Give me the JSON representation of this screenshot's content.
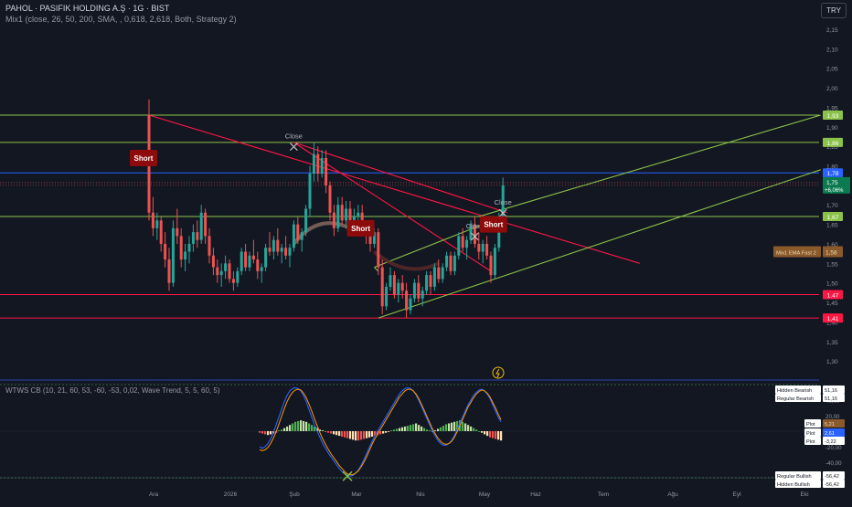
{
  "header": {
    "title": "PAHOL · PASIFIK HOLDING A.Ş · 1G · BIST",
    "indicator": "Mix1 (close, 26, 50, 200, SMA, , 0,618, 2,618, Both, Strategy 2)",
    "currency": "TRY"
  },
  "oscillator": {
    "title": "WTWS CB (10, 21, 60, 53, -60, -53, 0,02, Wave Trend, 5, 5, 60, 5)"
  },
  "colors": {
    "background": "#131722",
    "up": "#26a69a",
    "down": "#ef5350",
    "green_line": "#8bc34a",
    "red_line": "#ff1744",
    "blue_line": "#2962ff",
    "short_label": "#8e0b0b"
  },
  "chart_data": [
    {
      "type": "candlestick",
      "symbol": "PAHOL",
      "x_ticks": [
        "Ara",
        "2026",
        "Şub",
        "Mar",
        "Nis",
        "May",
        "Haz",
        "Tem",
        "Ağu",
        "Eyl",
        "Eki"
      ],
      "y_ticks": [
        "2,15",
        "2,10",
        "2,05",
        "2,00",
        "1,95",
        "1,90",
        "1,85",
        "1,80",
        "1,75",
        "1,70",
        "1,65",
        "1,60",
        "1,55",
        "1,50",
        "1,45",
        "1,40",
        "1,35",
        "1,30"
      ],
      "ylim": [
        1.28,
        2.17
      ],
      "last_price": "1,75",
      "change": "+6,06%",
      "horizontal_levels": [
        {
          "label": "1,93",
          "value": 1.93,
          "color": "#8bc34a"
        },
        {
          "label": "1,86",
          "value": 1.86,
          "color": "#8bc34a"
        },
        {
          "label": "1,78",
          "value": 1.782,
          "color": "#2962ff"
        },
        {
          "label": "1,67",
          "value": 1.67,
          "color": "#8bc34a"
        },
        {
          "label": "1,47",
          "value": 1.47,
          "color": "#ff1744"
        },
        {
          "label": "1,41",
          "value": 1.41,
          "color": "#ff1744"
        }
      ],
      "label_mix": "Mix1 EMA Fast 2",
      "label_mix_value": "1,58",
      "signals": [
        {
          "text": "Short",
          "kind": "short"
        },
        {
          "text": "Close",
          "kind": "close"
        },
        {
          "text": "Short",
          "kind": "short"
        },
        {
          "text": "Close",
          "kind": "close"
        },
        {
          "text": "Close",
          "kind": "close"
        },
        {
          "text": "Short",
          "kind": "short"
        }
      ],
      "candles": [
        [
          1.93,
          1.97,
          1.66,
          1.68
        ],
        [
          1.68,
          1.72,
          1.62,
          1.64
        ],
        [
          1.64,
          1.68,
          1.61,
          1.66
        ],
        [
          1.66,
          1.67,
          1.58,
          1.6
        ],
        [
          1.6,
          1.63,
          1.54,
          1.56
        ],
        [
          1.56,
          1.59,
          1.48,
          1.5
        ],
        [
          1.5,
          1.66,
          1.49,
          1.64
        ],
        [
          1.64,
          1.69,
          1.6,
          1.62
        ],
        [
          1.62,
          1.64,
          1.54,
          1.56
        ],
        [
          1.56,
          1.6,
          1.53,
          1.58
        ],
        [
          1.58,
          1.62,
          1.55,
          1.6
        ],
        [
          1.6,
          1.65,
          1.58,
          1.63
        ],
        [
          1.63,
          1.66,
          1.59,
          1.61
        ],
        [
          1.61,
          1.7,
          1.6,
          1.68
        ],
        [
          1.68,
          1.69,
          1.6,
          1.62
        ],
        [
          1.62,
          1.64,
          1.55,
          1.57
        ],
        [
          1.57,
          1.59,
          1.52,
          1.54
        ],
        [
          1.54,
          1.56,
          1.5,
          1.52
        ],
        [
          1.52,
          1.55,
          1.49,
          1.53
        ],
        [
          1.53,
          1.57,
          1.51,
          1.55
        ],
        [
          1.55,
          1.56,
          1.5,
          1.51
        ],
        [
          1.51,
          1.53,
          1.48,
          1.5
        ],
        [
          1.5,
          1.54,
          1.49,
          1.53
        ],
        [
          1.53,
          1.59,
          1.52,
          1.58
        ],
        [
          1.58,
          1.6,
          1.53,
          1.54
        ],
        [
          1.54,
          1.58,
          1.53,
          1.57
        ],
        [
          1.57,
          1.61,
          1.55,
          1.56
        ],
        [
          1.56,
          1.58,
          1.51,
          1.53
        ],
        [
          1.53,
          1.55,
          1.5,
          1.54
        ],
        [
          1.54,
          1.6,
          1.53,
          1.59
        ],
        [
          1.59,
          1.63,
          1.57,
          1.58
        ],
        [
          1.58,
          1.62,
          1.56,
          1.61
        ],
        [
          1.61,
          1.64,
          1.57,
          1.58
        ],
        [
          1.58,
          1.6,
          1.55,
          1.59
        ],
        [
          1.59,
          1.62,
          1.56,
          1.57
        ],
        [
          1.57,
          1.6,
          1.54,
          1.59
        ],
        [
          1.59,
          1.66,
          1.58,
          1.65
        ],
        [
          1.65,
          1.67,
          1.6,
          1.61
        ],
        [
          1.61,
          1.64,
          1.58,
          1.63
        ],
        [
          1.63,
          1.7,
          1.62,
          1.69
        ],
        [
          1.69,
          1.8,
          1.67,
          1.78
        ],
        [
          1.78,
          1.86,
          1.76,
          1.83
        ],
        [
          1.83,
          1.85,
          1.76,
          1.78
        ],
        [
          1.78,
          1.84,
          1.77,
          1.82
        ],
        [
          1.82,
          1.84,
          1.73,
          1.75
        ],
        [
          1.75,
          1.76,
          1.66,
          1.68
        ],
        [
          1.68,
          1.7,
          1.62,
          1.64
        ],
        [
          1.64,
          1.72,
          1.63,
          1.7
        ],
        [
          1.7,
          1.72,
          1.65,
          1.66
        ],
        [
          1.66,
          1.71,
          1.64,
          1.69
        ],
        [
          1.69,
          1.71,
          1.64,
          1.65
        ],
        [
          1.65,
          1.69,
          1.63,
          1.67
        ],
        [
          1.67,
          1.7,
          1.64,
          1.68
        ],
        [
          1.68,
          1.7,
          1.63,
          1.64
        ],
        [
          1.64,
          1.66,
          1.6,
          1.62
        ],
        [
          1.62,
          1.64,
          1.58,
          1.6
        ],
        [
          1.6,
          1.64,
          1.59,
          1.63
        ],
        [
          1.63,
          1.64,
          1.52,
          1.54
        ],
        [
          1.54,
          1.56,
          1.42,
          1.44
        ],
        [
          1.44,
          1.5,
          1.43,
          1.49
        ],
        [
          1.49,
          1.54,
          1.48,
          1.52
        ],
        [
          1.52,
          1.53,
          1.46,
          1.47
        ],
        [
          1.47,
          1.51,
          1.45,
          1.5
        ],
        [
          1.5,
          1.52,
          1.46,
          1.48
        ],
        [
          1.48,
          1.5,
          1.41,
          1.43
        ],
        [
          1.43,
          1.47,
          1.42,
          1.46
        ],
        [
          1.46,
          1.51,
          1.45,
          1.5
        ],
        [
          1.5,
          1.52,
          1.45,
          1.46
        ],
        [
          1.46,
          1.49,
          1.44,
          1.48
        ],
        [
          1.48,
          1.53,
          1.47,
          1.52
        ],
        [
          1.52,
          1.53,
          1.47,
          1.49
        ],
        [
          1.49,
          1.55,
          1.48,
          1.54
        ],
        [
          1.54,
          1.56,
          1.5,
          1.51
        ],
        [
          1.51,
          1.55,
          1.5,
          1.54
        ],
        [
          1.54,
          1.58,
          1.53,
          1.57
        ],
        [
          1.57,
          1.58,
          1.52,
          1.53
        ],
        [
          1.53,
          1.58,
          1.52,
          1.57
        ],
        [
          1.57,
          1.63,
          1.56,
          1.62
        ],
        [
          1.62,
          1.64,
          1.58,
          1.59
        ],
        [
          1.59,
          1.62,
          1.56,
          1.61
        ],
        [
          1.61,
          1.66,
          1.6,
          1.65
        ],
        [
          1.65,
          1.67,
          1.59,
          1.6
        ],
        [
          1.6,
          1.63,
          1.56,
          1.58
        ],
        [
          1.58,
          1.61,
          1.55,
          1.6
        ],
        [
          1.6,
          1.62,
          1.56,
          1.57
        ],
        [
          1.57,
          1.58,
          1.5,
          1.52
        ],
        [
          1.52,
          1.6,
          1.51,
          1.59
        ],
        [
          1.59,
          1.68,
          1.58,
          1.66
        ],
        [
          1.66,
          1.77,
          1.65,
          1.75
        ]
      ]
    },
    {
      "type": "oscillator",
      "y_ticks": [
        "40,00",
        "20,00",
        "-20,00",
        "-40,00"
      ],
      "ylim": [
        -62,
        62
      ],
      "labels": [
        {
          "name": "Hidden Bearish",
          "value": "51,16"
        },
        {
          "name": "Regular Bearish",
          "value": "51,16"
        },
        {
          "name": "Plot",
          "value": "5,21"
        },
        {
          "name": "Plot",
          "value": "2,61"
        },
        {
          "name": "Plot",
          "value": "-3,22"
        },
        {
          "name": "Regular Bullish",
          "value": "-56,42"
        },
        {
          "name": "Hidden Bullish",
          "value": "-56,42"
        }
      ],
      "histogram": [
        -2,
        -3,
        -4,
        -5,
        -4,
        -3,
        -2,
        1,
        2,
        4,
        6,
        8,
        10,
        12,
        13,
        14,
        13,
        12,
        10,
        8,
        6,
        4,
        2,
        1,
        -1,
        -2,
        -3,
        -4,
        -5,
        -6,
        -7,
        -8,
        -9,
        -10,
        -11,
        -12,
        -12,
        -11,
        -10,
        -9,
        -8,
        -7,
        -6,
        -5,
        -4,
        -3,
        -2,
        -1,
        1,
        2,
        3,
        4,
        5,
        6,
        7,
        8,
        9,
        10,
        8,
        6,
        4,
        2,
        1,
        0,
        1,
        3,
        5,
        7,
        9,
        10,
        11,
        12,
        13,
        14,
        12,
        10,
        8,
        6,
        4,
        2,
        0,
        -2,
        -4,
        -6,
        -8,
        -9,
        -10,
        -11,
        -12
      ],
      "wave1": [
        -20,
        -22,
        -20,
        -16,
        -10,
        -2,
        8,
        18,
        28,
        38,
        46,
        52,
        55,
        56,
        55,
        52,
        46,
        38,
        28,
        18,
        8,
        0,
        -8,
        -16,
        -22,
        -28,
        -33,
        -38,
        -43,
        -48,
        -52,
        -55,
        -57,
        -58,
        -57,
        -54,
        -50,
        -44,
        -37,
        -29,
        -21,
        -13,
        -6,
        0,
        6,
        12,
        18,
        24,
        30,
        36,
        42,
        48,
        52,
        55,
        56,
        55,
        52,
        47,
        40,
        32,
        24,
        16,
        8,
        0,
        -6,
        -12,
        -16,
        -18,
        -18,
        -16,
        -12,
        -6,
        2,
        10,
        18,
        26,
        34,
        40,
        46,
        50,
        53,
        54,
        52,
        48,
        42,
        34,
        26,
        18,
        12
      ],
      "wave2": [
        -24,
        -25,
        -24,
        -21,
        -16,
        -9,
        -1,
        9,
        19,
        29,
        38,
        45,
        50,
        53,
        54,
        53,
        49,
        43,
        35,
        26,
        16,
        7,
        -2,
        -10,
        -17,
        -23,
        -29,
        -34,
        -39,
        -44,
        -48,
        -52,
        -55,
        -56,
        -56,
        -54,
        -51,
        -46,
        -40,
        -33,
        -25,
        -17,
        -10,
        -4,
        2,
        8,
        14,
        20,
        26,
        32,
        38,
        44,
        48,
        52,
        54,
        54,
        52,
        48,
        42,
        35,
        27,
        19,
        11,
        3,
        -3,
        -9,
        -13,
        -16,
        -17,
        -16,
        -13,
        -8,
        -1,
        7,
        15,
        23,
        31,
        37,
        43,
        48,
        51,
        53,
        52,
        49,
        44,
        37,
        30,
        22,
        15
      ]
    }
  ],
  "axis_tags": {
    "osc_top_levels": [
      "Hidden Bearish",
      "Regular Bearish"
    ]
  }
}
